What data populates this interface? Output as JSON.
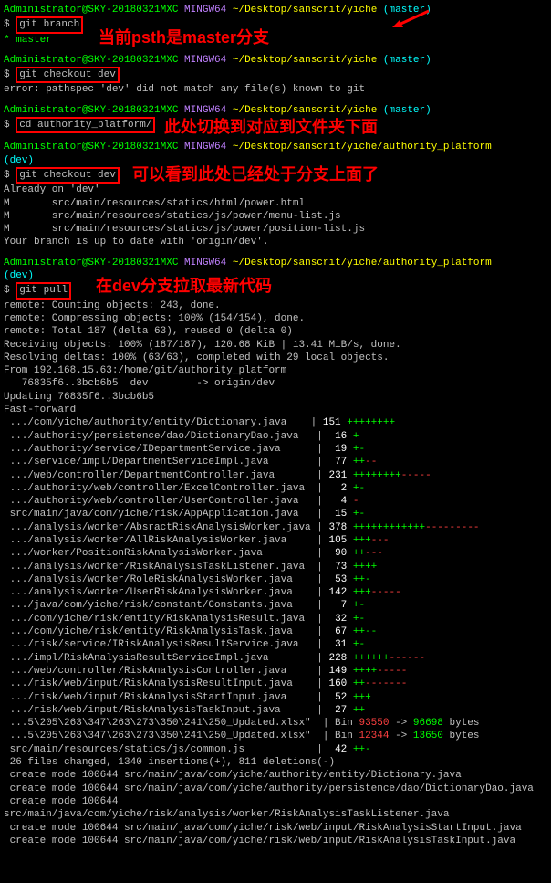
{
  "ps1_user": "Administrator@SKY-20180321MXC",
  "ps1_env": "MINGW64",
  "ps1_path1": "~/Desktop/sanscrit/yiche",
  "ps1_branch1": "(master)",
  "cmd1": "git branch",
  "out1": "* master",
  "ann1": "当前psth是master分支",
  "cmd2": "git checkout dev",
  "out2": "error: pathspec 'dev' did not match any file(s) known to git",
  "cmd3": "cd authority_platform/",
  "ann2": "此处切换到对应到文件夹下面",
  "ps1_path2": "~/Desktop/sanscrit/yiche/authority_platform",
  "ps1_branch2": "(dev)",
  "cmd4": "git checkout dev",
  "ann3": "可以看到此处已经处于分支上面了",
  "out4_1": "Already on 'dev'",
  "out4_2": "M       src/main/resources/statics/html/power.html",
  "out4_3": "M       src/main/resources/statics/js/power/menu-list.js",
  "out4_4": "M       src/main/resources/statics/js/power/position-list.js",
  "out4_5": "Your branch is up to date with 'origin/dev'.",
  "cmd5": "git pull",
  "ann4": "在dev分支拉取最新代码",
  "pull": {
    "l1": "remote: Counting objects: 243, done.",
    "l2": "remote: Compressing objects: 100% (154/154), done.",
    "l3": "remote: Total 187 (delta 63), reused 0 (delta 0)",
    "l4": "Receiving objects: 100% (187/187), 120.68 KiB | 13.41 MiB/s, done.",
    "l5": "Resolving deltas: 100% (63/63), completed with 29 local objects.",
    "l6": "From 192.168.15.63:/home/git/authority_platform",
    "l7": "   76835f6..3bcb6b5  dev        -> origin/dev",
    "l8": "Updating 76835f6..3bcb6b5",
    "l9": "Fast-forward"
  },
  "files": [
    {
      "path": " .../com/yiche/authority/entity/Dictionary.java    | ",
      "num": "151",
      "diff": " ++++++++"
    },
    {
      "path": " .../authority/persistence/dao/DictionaryDao.java   | ",
      "num": " 16",
      "diff": " +"
    },
    {
      "path": " .../authority/service/IDepartmentService.java      | ",
      "num": " 19",
      "diff": " +-"
    },
    {
      "path": " .../service/impl/DepartmentServiceImpl.java        | ",
      "num": " 77",
      "diff": " ++",
      "diffr": "--"
    },
    {
      "path": " .../web/controller/DepartmentController.java       | ",
      "num": "231",
      "diff": " ++++++++",
      "diffr": "-----"
    },
    {
      "path": " .../authority/web/controller/ExcelController.java  | ",
      "num": "  2",
      "diff": " +-"
    },
    {
      "path": " .../authority/web/controller/UserController.java   | ",
      "num": "  4",
      "diff": " ",
      "diffr": "-"
    },
    {
      "path": " src/main/java/com/yiche/risk/AppApplication.java   | ",
      "num": " 15",
      "diff": " +-"
    },
    {
      "path": " .../analysis/worker/AbsractRiskAnalysisWorker.java | ",
      "num": "378",
      "diff": " ++++++++++++",
      "diffr": "---------"
    },
    {
      "path": " .../analysis/worker/AllRiskAnalysisWorker.java     | ",
      "num": "105",
      "diff": " +++",
      "diffr": "---"
    },
    {
      "path": " .../worker/PositionRiskAnalysisWorker.java         | ",
      "num": " 90",
      "diff": " ++",
      "diffr": "---"
    },
    {
      "path": " .../analysis/worker/RiskAnalysisTaskListener.java  | ",
      "num": " 73",
      "diff": " ++++"
    },
    {
      "path": " .../analysis/worker/RoleRiskAnalysisWorker.java    | ",
      "num": " 53",
      "diff": " ++-"
    },
    {
      "path": " .../analysis/worker/UserRiskAnalysisWorker.java    | ",
      "num": "142",
      "diff": " +++",
      "diffr": "-----"
    },
    {
      "path": " .../java/com/yiche/risk/constant/Constants.java    | ",
      "num": "  7",
      "diff": " +-"
    },
    {
      "path": " .../com/yiche/risk/entity/RiskAnalysisResult.java  | ",
      "num": " 32",
      "diff": " +-"
    },
    {
      "path": " .../com/yiche/risk/entity/RiskAnalysisTask.java    | ",
      "num": " 67",
      "diff": " ++--"
    },
    {
      "path": " .../risk/service/IRiskAnalysisResultService.java   | ",
      "num": " 31",
      "diff": " +-"
    },
    {
      "path": " .../impl/RiskAnalysisResultServiceImpl.java        | ",
      "num": "228",
      "diff": " ++++++",
      "diffr": "------"
    },
    {
      "path": " .../web/controller/RiskAnalysisController.java     | ",
      "num": "149",
      "diff": " ++++",
      "diffr": "-----"
    },
    {
      "path": " .../risk/web/input/RiskAnalysisResultInput.java    | ",
      "num": "160",
      "diff": " ++",
      "diffr": "-------"
    },
    {
      "path": " .../risk/web/input/RiskAnalysisStartInput.java     | ",
      "num": " 52",
      "diff": " +++"
    },
    {
      "path": " .../risk/web/input/RiskAnalysisTaskInput.java      | ",
      "num": " 27",
      "diff": " ++"
    }
  ],
  "binfiles": [
    {
      "path": " ...5\\205\\263\\347\\263\\273\\350\\241\\250_Updated.xlsx\"  | Bin ",
      "from": "93550",
      "to": "96698",
      "suffix": " bytes"
    },
    {
      "path": " ...5\\205\\263\\347\\263\\273\\350\\241\\250_Updated.xlsx\"  | Bin ",
      "from": "12344",
      "to": "13650",
      "suffix": " bytes"
    }
  ],
  "common": {
    "path": " src/main/resources/statics/js/common.js            | ",
    "num": " 42",
    "diff": " ++-"
  },
  "summary": " 26 files changed, 1340 insertions(+), 811 deletions(-)",
  "creates": [
    " create mode 100644 src/main/java/com/yiche/authority/entity/Dictionary.java",
    " create mode 100644 src/main/java/com/yiche/authority/persistence/dao/DictionaryDao.java",
    " create mode 100644 src/main/java/com/yiche/risk/analysis/worker/RiskAnalysisTaskListener.java",
    " create mode 100644 src/main/java/com/yiche/risk/web/input/RiskAnalysisStartInput.java",
    " create mode 100644 src/main/java/com/yiche/risk/web/input/RiskAnalysisTaskInput.java"
  ]
}
